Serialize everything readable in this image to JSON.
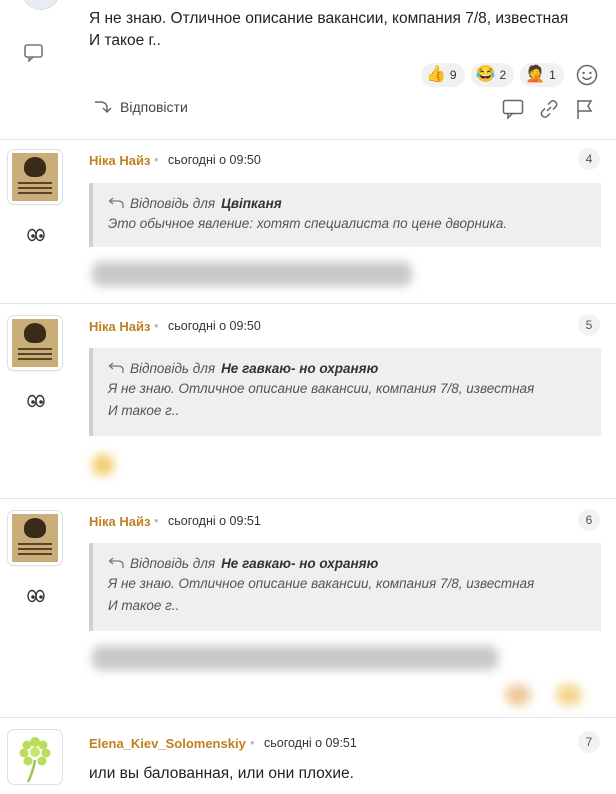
{
  "top_comment": {
    "text_line1": "Я не знаю. Отличное описание вакансии, компания 7/8, известная",
    "text_line2": "И такое г..",
    "reactions": [
      {
        "emoji": "👍",
        "count": "9"
      },
      {
        "emoji": "😂",
        "count": "2"
      },
      {
        "emoji": "🤦",
        "count": "1"
      }
    ],
    "reply_label": "Відповісти"
  },
  "comments": [
    {
      "author": "Ніка Найз",
      "time": "сьогодні о 09:50",
      "number": "4",
      "reply_prefix": "Відповідь для",
      "reply_to": "Цвіпканя",
      "quote_line1": "Это обычное явление: хотят специалиста по цене дворника.",
      "quote_line2": ""
    },
    {
      "author": "Ніка Найз",
      "time": "сьогодні о 09:50",
      "number": "5",
      "reply_prefix": "Відповідь для",
      "reply_to": "Не гавкаю- но охраняю",
      "quote_line1": "Я не знаю. Отличное описание вакансии, компания 7/8, известная",
      "quote_line2": "И такое г.."
    },
    {
      "author": "Ніка Найз",
      "time": "сьогодні о 09:51",
      "number": "6",
      "reply_prefix": "Відповідь для",
      "reply_to": "Не гавкаю- но охраняю",
      "quote_line1": "Я не знаю. Отличное описание вакансии, компания 7/8, известная",
      "quote_line2": "И такое г.."
    },
    {
      "author": "Elena_Kiev_Solomenskiy",
      "time": "сьогодні о 09:51",
      "number": "7",
      "text": "или вы балованная, или они плохие."
    }
  ],
  "colors": {
    "author": "#c08020",
    "quote_bg": "#efefef",
    "divider": "#e4e4e4"
  }
}
